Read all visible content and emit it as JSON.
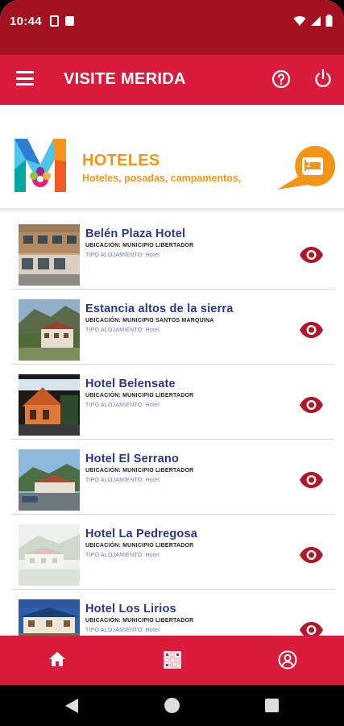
{
  "status_bar": {
    "time": "10:44",
    "icons": [
      "sim-card-icon",
      "image-icon",
      "wifi-icon",
      "signal-icon",
      "battery-icon"
    ]
  },
  "app_bar": {
    "title": "VISITE MERIDA",
    "left_icon": "menu-icon",
    "right_icons": [
      "help-icon",
      "power-icon"
    ]
  },
  "header": {
    "title": "HOTELES",
    "subtitle": "Hoteles, posadas, campamentos,",
    "badge_icon": "hotel-bed-icon"
  },
  "hotels": [
    {
      "name": "Belén Plaza Hotel",
      "location": "UBICACIÓN: MUNICIPIO LIBERTADOR",
      "type": "TIPO ALOJAMIENTO: Hotel"
    },
    {
      "name": "Estancia altos de la sierra",
      "location": "UBICACIÓN: MUNICIPIO SANTOS MARQUINA",
      "type": "TIPO ALOJAMIENTO: Hotel"
    },
    {
      "name": "Hotel Belensate",
      "location": "UBICACIÓN: MUNICIPIO LIBERTADOR",
      "type": "TIPO ALOJAMIENTO: Hotel"
    },
    {
      "name": "Hotel El Serrano",
      "location": "UBICACIÓN: MUNICIPIO LIBERTADOR",
      "type": "TIPO ALOJAMIENTO: Hotel"
    },
    {
      "name": "Hotel La Pedregosa",
      "location": "UBICACIÓN: MUNICIPIO LIBERTADOR",
      "type": "TIPO ALOJAMIENTO: Hotel"
    },
    {
      "name": "Hotel Los Lirios",
      "location": "UBICACIÓN: MUNICIPIO LIBERTADOR",
      "type": "TIPO ALOJAMIENTO: Hotel"
    }
  ],
  "bottom_nav": [
    "home-icon",
    "qr-code-icon",
    "account-icon"
  ],
  "colors": {
    "status_bar": "#a2121f",
    "primary": "#d91c3b",
    "accent": "#f39417",
    "hotel_name": "#283593",
    "hotel_type": "#6a78d8",
    "eye": "#b0182a"
  }
}
